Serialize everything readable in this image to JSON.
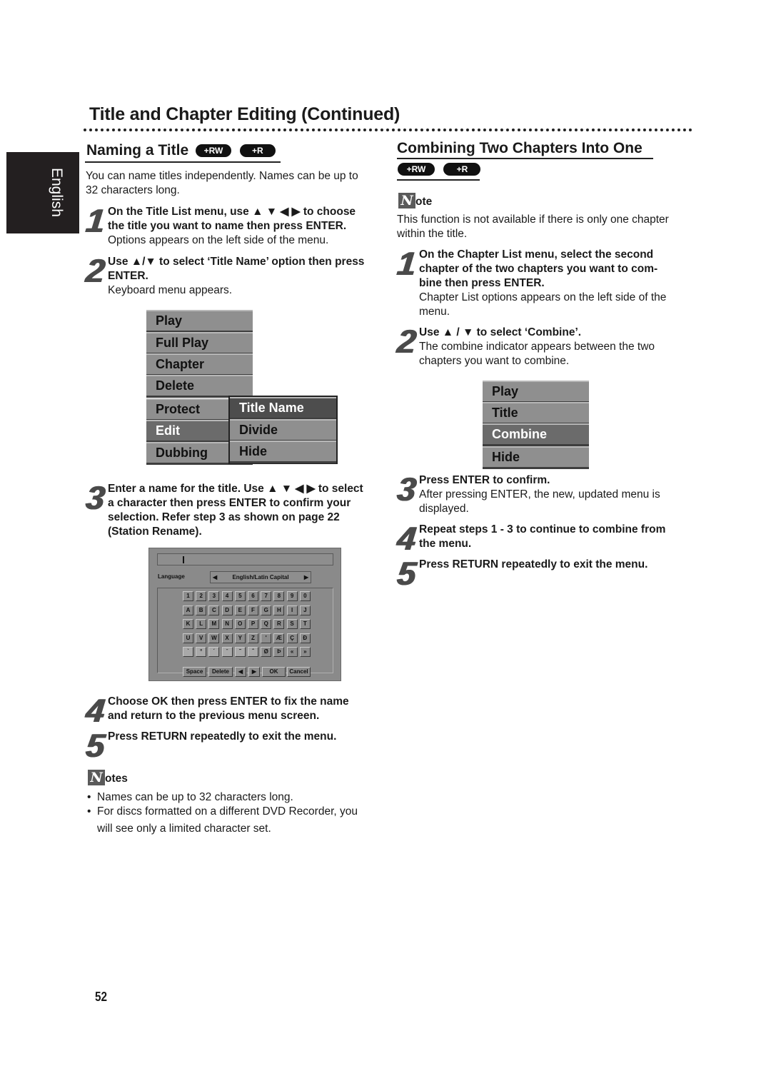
{
  "page": {
    "title": "Title and Chapter Editing (Continued)",
    "language_tab": "English",
    "page_number": "52"
  },
  "left": {
    "heading": "Naming a Title",
    "badges": [
      "+RW",
      "+R"
    ],
    "intro": [
      "You can name titles independently. Names can be up to",
      "32 characters long."
    ],
    "steps": [
      {
        "num": "1",
        "bold": [
          "On the Title List menu, use ▲ ▼ ◀ ▶ to choose",
          "the title you want to name then press ENTER."
        ],
        "normal": [
          "Options appears on the left side of the menu."
        ]
      },
      {
        "num": "2",
        "bold": [
          "Use ▲/▼ to select ‘Title Name’ option then press",
          "ENTER."
        ],
        "normal": [
          "Keyboard menu appears."
        ]
      },
      {
        "num": "3",
        "bold": [
          "Enter a name for the title. Use ▲ ▼ ◀ ▶ to select",
          "a character then press ENTER to confirm your",
          "selection. Refer step 3 as shown on page 22",
          "(Station Rename)."
        ],
        "normal": []
      },
      {
        "num": "4",
        "bold": [
          "Choose OK then press ENTER to fix the name",
          "and return to the previous menu screen."
        ],
        "normal": []
      },
      {
        "num": "5",
        "bold": [
          "Press RETURN repeatedly to exit the menu."
        ],
        "normal": []
      }
    ],
    "title_menu": {
      "items": [
        "Play",
        "Full Play",
        "Chapter",
        "Delete",
        "Protect",
        "Edit",
        "Dubbing"
      ],
      "selected": "Edit",
      "submenu": [
        "Title Name",
        "Divide",
        "Hide"
      ],
      "submenu_highlighted": "Title Name"
    },
    "keyboard": {
      "input_value": "",
      "language_label": "Language",
      "language_value": "English/Latin Capital",
      "rows": [
        [
          "1",
          "2",
          "3",
          "4",
          "5",
          "6",
          "7",
          "8",
          "9",
          "0"
        ],
        [
          "A",
          "B",
          "C",
          "D",
          "E",
          "F",
          "G",
          "H",
          "I",
          "J"
        ],
        [
          "K",
          "L",
          "M",
          "N",
          "O",
          "P",
          "Q",
          "R",
          "S",
          "T"
        ],
        [
          "U",
          "V",
          "W",
          "X",
          "Y",
          "Z",
          "'",
          "Æ",
          "Ç",
          "Ð"
        ],
        [
          "ˋ",
          "°",
          "ˊ",
          "ˉ",
          "˜",
          "ˆ",
          "Ø",
          "Þ",
          "«",
          "»"
        ]
      ],
      "function_keys": [
        "Space",
        "Delete",
        "◀",
        "▶",
        "OK",
        "Cancel"
      ]
    },
    "notes": {
      "icon_letter": "N",
      "label": "otes",
      "items": [
        "Names can be up to 32 characters long.",
        "For discs formatted on a different DVD Recorder, you",
        "will see only a limited character set."
      ]
    }
  },
  "right": {
    "heading": "Combining Two Chapters Into One",
    "badges": [
      "+RW",
      "+R"
    ],
    "note": {
      "icon_letter": "N",
      "label": "ote",
      "text": [
        "This function is not available if there is only one chapter",
        "within the title."
      ]
    },
    "steps": [
      {
        "num": "1",
        "bold": [
          "On the Chapter List menu, select the second",
          "chapter of the two chapters you want to com-",
          "bine then press ENTER."
        ],
        "normal": [
          "Chapter List options appears on the left side of the",
          "menu."
        ]
      },
      {
        "num": "2",
        "bold": [
          "Use ▲ / ▼ to select ‘Combine’."
        ],
        "normal": [
          "The combine indicator appears between the two",
          "chapters you want to combine."
        ]
      },
      {
        "num": "3",
        "bold": [
          "Press ENTER to confirm."
        ],
        "normal": [
          "After pressing ENTER, the new, updated menu is",
          "displayed."
        ]
      },
      {
        "num": "4",
        "bold": [
          "Repeat steps 1 - 3 to continue to combine from",
          "the menu."
        ],
        "normal": []
      },
      {
        "num": "5",
        "bold": [
          "Press RETURN repeatedly to exit the menu."
        ],
        "normal": []
      }
    ],
    "chapter_menu": {
      "items": [
        "Play",
        "Title",
        "Combine",
        "Hide"
      ],
      "selected": "Combine"
    }
  }
}
